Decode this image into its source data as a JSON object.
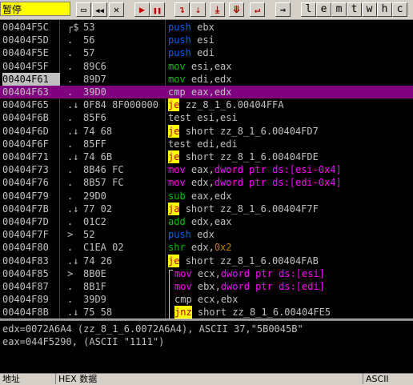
{
  "toolbar": {
    "status": "暂停",
    "buttons": [
      {
        "name": "open-icon",
        "glyph": "▭"
      },
      {
        "name": "restart-icon",
        "glyph": "◀◀"
      },
      {
        "name": "close-icon",
        "glyph": "✕"
      },
      {
        "name": "run-icon",
        "glyph": "▶"
      },
      {
        "name": "pause-icon",
        "glyph": "❚❚"
      },
      {
        "name": "step-into-icon",
        "glyph": "↴"
      },
      {
        "name": "step-over-icon",
        "glyph": "⇣"
      },
      {
        "name": "trace-into-icon",
        "glyph": "⤓"
      },
      {
        "name": "trace-over-icon",
        "glyph": "⤋"
      },
      {
        "name": "execute-till-return-icon",
        "glyph": "↵"
      },
      {
        "name": "go-to-icon",
        "glyph": "→"
      }
    ],
    "letters": [
      "l",
      "e",
      "m",
      "t",
      "w",
      "h",
      "c"
    ]
  },
  "disasm": {
    "rows": [
      {
        "addr": "00404F5C",
        "mark": "┌$",
        "hex": "53",
        "mn": "push",
        "cls": "stack",
        "ops": [
          [
            "ebx",
            ""
          ]
        ]
      },
      {
        "addr": "00404F5D",
        "mark": ".",
        "hex": "56",
        "mn": "push",
        "cls": "stack",
        "ops": [
          [
            "esi",
            ""
          ]
        ]
      },
      {
        "addr": "00404F5E",
        "mark": ".",
        "hex": "57",
        "mn": "push",
        "cls": "stack",
        "ops": [
          [
            "edi",
            ""
          ]
        ]
      },
      {
        "addr": "00404F5F",
        "mark": ".",
        "hex": "89C6",
        "mn": "mov",
        "cls": "arith",
        "ops": [
          [
            "esi,eax",
            ""
          ]
        ]
      },
      {
        "addr": "00404F61",
        "mark": ".",
        "hex": "89D7",
        "mn": "mov",
        "cls": "arith",
        "ops": [
          [
            "edi,edx",
            ""
          ]
        ],
        "addr_hl": true
      },
      {
        "addr": "00404F63",
        "mark": ".",
        "hex": "39D0",
        "mn": "cmp",
        "cls": "normal",
        "ops": [
          [
            "eax,edx",
            ""
          ]
        ],
        "selected": true
      },
      {
        "addr": "00404F65",
        "mark": ".↓",
        "hex": "0F84 8F000000",
        "mn": "je",
        "cls": "jcc",
        "ops": [
          [
            "zz_8_1_6.00404FFA",
            ""
          ]
        ]
      },
      {
        "addr": "00404F6B",
        "mark": ".",
        "hex": "85F6",
        "mn": "test",
        "cls": "normal",
        "ops": [
          [
            "esi,esi",
            ""
          ]
        ]
      },
      {
        "addr": "00404F6D",
        "mark": ".↓",
        "hex": "74 68",
        "mn": "je",
        "cls": "jcc",
        "ops": [
          [
            "short zz_8_1_6.00404FD7",
            ""
          ]
        ]
      },
      {
        "addr": "00404F6F",
        "mark": ".",
        "hex": "85FF",
        "mn": "test",
        "cls": "normal",
        "ops": [
          [
            "edi,edi",
            ""
          ]
        ]
      },
      {
        "addr": "00404F71",
        "mark": ".↓",
        "hex": "74 6B",
        "mn": "je",
        "cls": "jcc",
        "ops": [
          [
            "short zz_8_1_6.00404FDE",
            ""
          ]
        ]
      },
      {
        "addr": "00404F73",
        "mark": ".",
        "hex": "8B46 FC",
        "mn": "mov",
        "cls": "mov",
        "ops": [
          [
            "eax,",
            ""
          ],
          [
            "dword ptr ds:[esi-0x4]",
            "mem"
          ]
        ]
      },
      {
        "addr": "00404F76",
        "mark": ".",
        "hex": "8B57 FC",
        "mn": "mov",
        "cls": "mov",
        "ops": [
          [
            "edx,",
            ""
          ],
          [
            "dword ptr ds:[edi-0x4]",
            "mem"
          ]
        ]
      },
      {
        "addr": "00404F79",
        "mark": ".",
        "hex": "29D0",
        "mn": "sub",
        "cls": "arith",
        "ops": [
          [
            "eax,edx",
            ""
          ]
        ]
      },
      {
        "addr": "00404F7B",
        "mark": ".↓",
        "hex": "77 02",
        "mn": "ja",
        "cls": "jcc",
        "ops": [
          [
            "short zz_8_1_6.00404F7F",
            ""
          ]
        ]
      },
      {
        "addr": "00404F7D",
        "mark": ".",
        "hex": "01C2",
        "mn": "add",
        "cls": "arith",
        "ops": [
          [
            "edx,eax",
            ""
          ]
        ]
      },
      {
        "addr": "00404F7F",
        "mark": ">",
        "hex": "52",
        "mn": "push",
        "cls": "stack",
        "ops": [
          [
            "edx",
            ""
          ]
        ]
      },
      {
        "addr": "00404F80",
        "mark": ".",
        "hex": "C1EA 02",
        "mn": "shr",
        "cls": "arith",
        "ops": [
          [
            "edx,",
            ""
          ],
          [
            "0x2",
            "imm"
          ]
        ]
      },
      {
        "addr": "00404F83",
        "mark": ".↓",
        "hex": "74 26",
        "mn": "je",
        "cls": "jcc",
        "ops": [
          [
            "short zz_8_1_6.00404FAB",
            ""
          ]
        ]
      },
      {
        "addr": "00404F85",
        "mark": ">",
        "hex": "8B0E",
        "mn": "mov",
        "cls": "mov",
        "ops": [
          [
            "ecx,",
            ""
          ],
          [
            "dword ptr ds:[esi]",
            "mem"
          ]
        ],
        "indent": true
      },
      {
        "addr": "00404F87",
        "mark": ".",
        "hex": "8B1F",
        "mn": "mov",
        "cls": "mov",
        "ops": [
          [
            "ebx,",
            ""
          ],
          [
            "dword ptr ds:[edi]",
            "mem"
          ]
        ],
        "indent": true
      },
      {
        "addr": "00404F89",
        "mark": ".",
        "hex": "39D9",
        "mn": "cmp",
        "cls": "normal",
        "ops": [
          [
            "ecx,ebx",
            ""
          ]
        ],
        "indent": true
      },
      {
        "addr": "00404F8B",
        "mark": ".↓",
        "hex": "75 58",
        "mn": "jnz",
        "cls": "jcc",
        "ops": [
          [
            "short zz_8_1_6.00404FE5",
            ""
          ]
        ],
        "indent": true
      }
    ]
  },
  "info": {
    "line1": "edx=0072A6A4 (zz_8_1_6.0072A6A4), ASCII 37,\"5B0045B\"",
    "line2": "eax=044F5290, (ASCII \"1111\")"
  },
  "dump_header": {
    "address": "地址",
    "hex": "HEX 数据",
    "ascii": "ASCII"
  }
}
